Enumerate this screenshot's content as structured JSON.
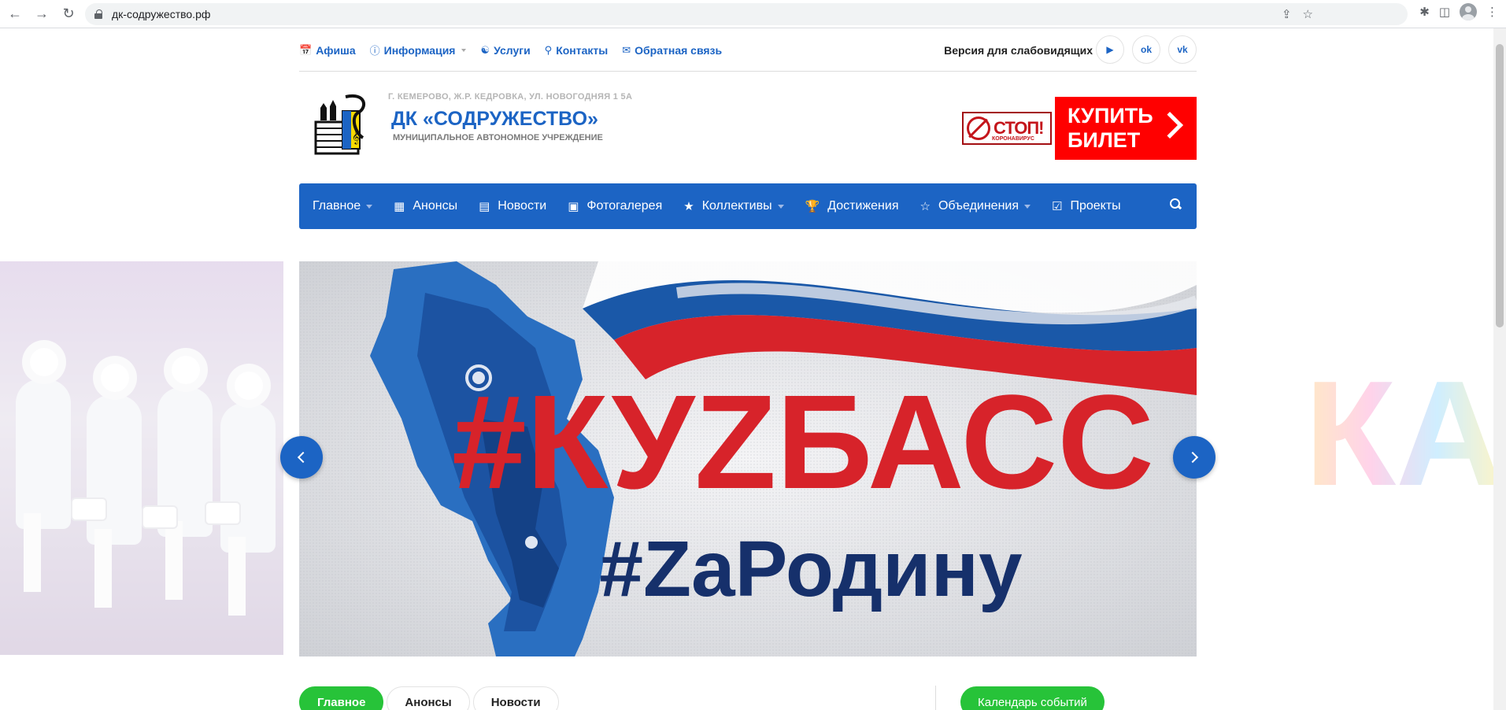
{
  "browser": {
    "url": "дк-содружество.рф"
  },
  "topbar": {
    "items": [
      {
        "label": "Афиша",
        "icon": "calendar-icon"
      },
      {
        "label": "Информация",
        "icon": "info-icon",
        "dropdown": true
      },
      {
        "label": "Услуги",
        "icon": "services-icon"
      },
      {
        "label": "Контакты",
        "icon": "map-marker-icon"
      },
      {
        "label": "Обратная связь",
        "icon": "envelope-icon"
      }
    ],
    "vision_label": "Версия для слабовидящих",
    "socials": [
      {
        "name": "youtube",
        "glyph": "▶"
      },
      {
        "name": "odnoklassniki",
        "glyph": "ok"
      },
      {
        "name": "vkontakte",
        "glyph": "vk"
      }
    ]
  },
  "header": {
    "address": "Г. КЕМЕРОВО, Ж.Р. КЕДРОВКА, УЛ. НОВОГОДНЯЯ 1 5А",
    "name": "ДК «СОДРУЖЕСТВО»",
    "subtitle": "МУНИЦИПАЛЬНОЕ АВТОНОМНОЕ УЧРЕЖДЕНИЕ",
    "covid_banner": {
      "stop": "СТОП!",
      "sub": "КОРОНАВИРУС"
    },
    "buy_banner": {
      "line1": "КУПИТЬ",
      "line2": "БИЛЕТ"
    }
  },
  "menu": {
    "items": [
      {
        "label": "Главное",
        "icon": "",
        "dropdown": true
      },
      {
        "label": "Анонсы",
        "icon": "calendar-icon",
        "dropdown": false
      },
      {
        "label": "Новости",
        "icon": "newspaper-icon",
        "dropdown": false
      },
      {
        "label": "Фотогалерея",
        "icon": "image-icon",
        "dropdown": false
      },
      {
        "label": "Коллективы",
        "icon": "star-icon",
        "dropdown": true
      },
      {
        "label": "Достижения",
        "icon": "trophy-icon",
        "dropdown": false
      },
      {
        "label": "Объединения",
        "icon": "star-outline-icon",
        "dropdown": true
      },
      {
        "label": "Проекты",
        "icon": "checkbox-icon",
        "dropdown": false
      }
    ]
  },
  "slide": {
    "headline": "#КУZБАСС",
    "subline": "#ZаРодину",
    "colors": {
      "red": "#d7232a",
      "navy": "#16306b",
      "blue": "#1a58a8"
    }
  },
  "tabs": {
    "items": [
      "Главное",
      "Анонсы",
      "Новости"
    ],
    "active": 0,
    "calendar_label": "Календарь событий"
  },
  "colors": {
    "brand": "#1c64c4",
    "green": "#27c339",
    "buy_red": "#ff0000"
  }
}
